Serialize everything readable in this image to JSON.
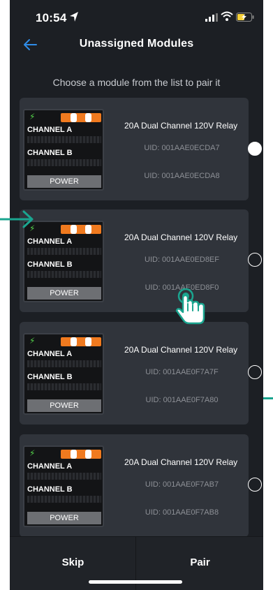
{
  "status_bar": {
    "time": "10:54"
  },
  "nav": {
    "title": "Unassigned Modules"
  },
  "subtitle": "Choose a module from the list to pair it",
  "module_image": {
    "channel_a": "CHANNEL A",
    "channel_b": "CHANNEL B",
    "power": "POWER"
  },
  "modules": [
    {
      "name": "20A Dual Channel 120V Relay",
      "uid_a": "UID: 001AAE0ECDA7",
      "uid_b": "UID: 001AAE0ECDA8",
      "selected": true
    },
    {
      "name": "20A Dual Channel 120V Relay",
      "uid_a": "UID: 001AAE0ED8EF",
      "uid_b": "UID: 001AAE0ED8F0",
      "selected": false
    },
    {
      "name": "20A Dual Channel 120V Relay",
      "uid_a": "UID: 001AAE0F7A7F",
      "uid_b": "UID: 001AAE0F7A80",
      "selected": false
    },
    {
      "name": "20A Dual Channel 120V Relay",
      "uid_a": "UID: 001AAE0F7AB7",
      "uid_b": "UID: 001AAE0F7AB8",
      "selected": false
    }
  ],
  "buttons": {
    "skip": "Skip",
    "pair": "Pair"
  },
  "colors": {
    "background": "#1c1f24",
    "card": "#30343b",
    "accent_teal": "#1aa58f",
    "power_orange": "#f07a1f",
    "back_arrow": "#2f8ce8"
  },
  "icons": [
    "location-arrow-icon",
    "cellular-signal-icon",
    "wifi-icon",
    "battery-charging-icon",
    "back-arrow-icon",
    "lightning-bolt-icon",
    "tap-pointer-icon"
  ]
}
